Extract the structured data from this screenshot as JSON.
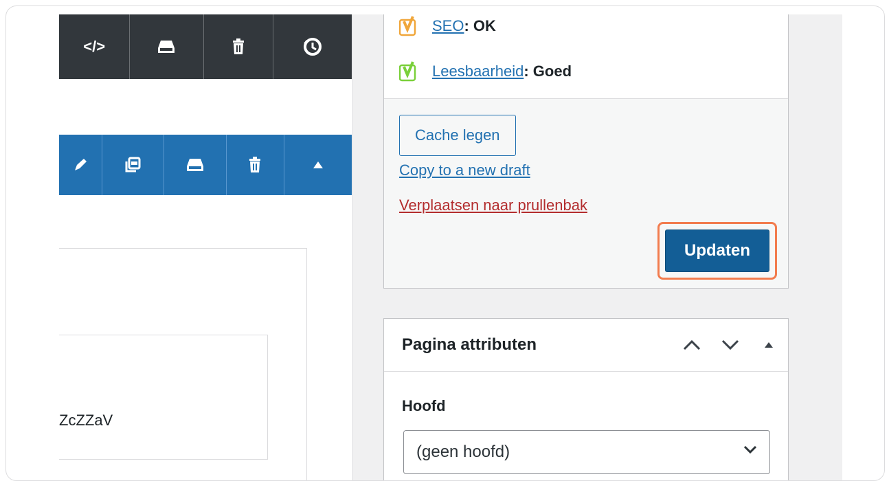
{
  "editor": {
    "dark_toolbar_icons": [
      "code-icon",
      "database-icon",
      "trash-icon",
      "history-icon"
    ],
    "dark_toolbar_code_glyph": "</>",
    "blue_toolbar_icons": [
      "edit-icon",
      "duplicate-icon",
      "database-icon",
      "trash-icon",
      "arrow-up-icon"
    ],
    "snippet_text": "ZcZZaV"
  },
  "sidebar": {
    "seo": {
      "link": "SEO",
      "status": ": OK",
      "accent": "#f0a63a"
    },
    "readability": {
      "link": "Leesbaarheid",
      "status": ": Goed",
      "accent": "#7ad03a"
    },
    "cache_button": "Cache legen",
    "copy_link": "Copy to a new draft",
    "trash_link": "Verplaatsen naar prullenbak",
    "update_button": "Updaten",
    "page_attributes": {
      "title": "Pagina attributen",
      "parent_label": "Hoofd",
      "parent_value": "(geen hoofd)"
    }
  },
  "colors": {
    "primary": "#135e96",
    "highlight_ring": "#f27c4e",
    "link": "#2271b1",
    "danger_link": "#b32d2e"
  }
}
